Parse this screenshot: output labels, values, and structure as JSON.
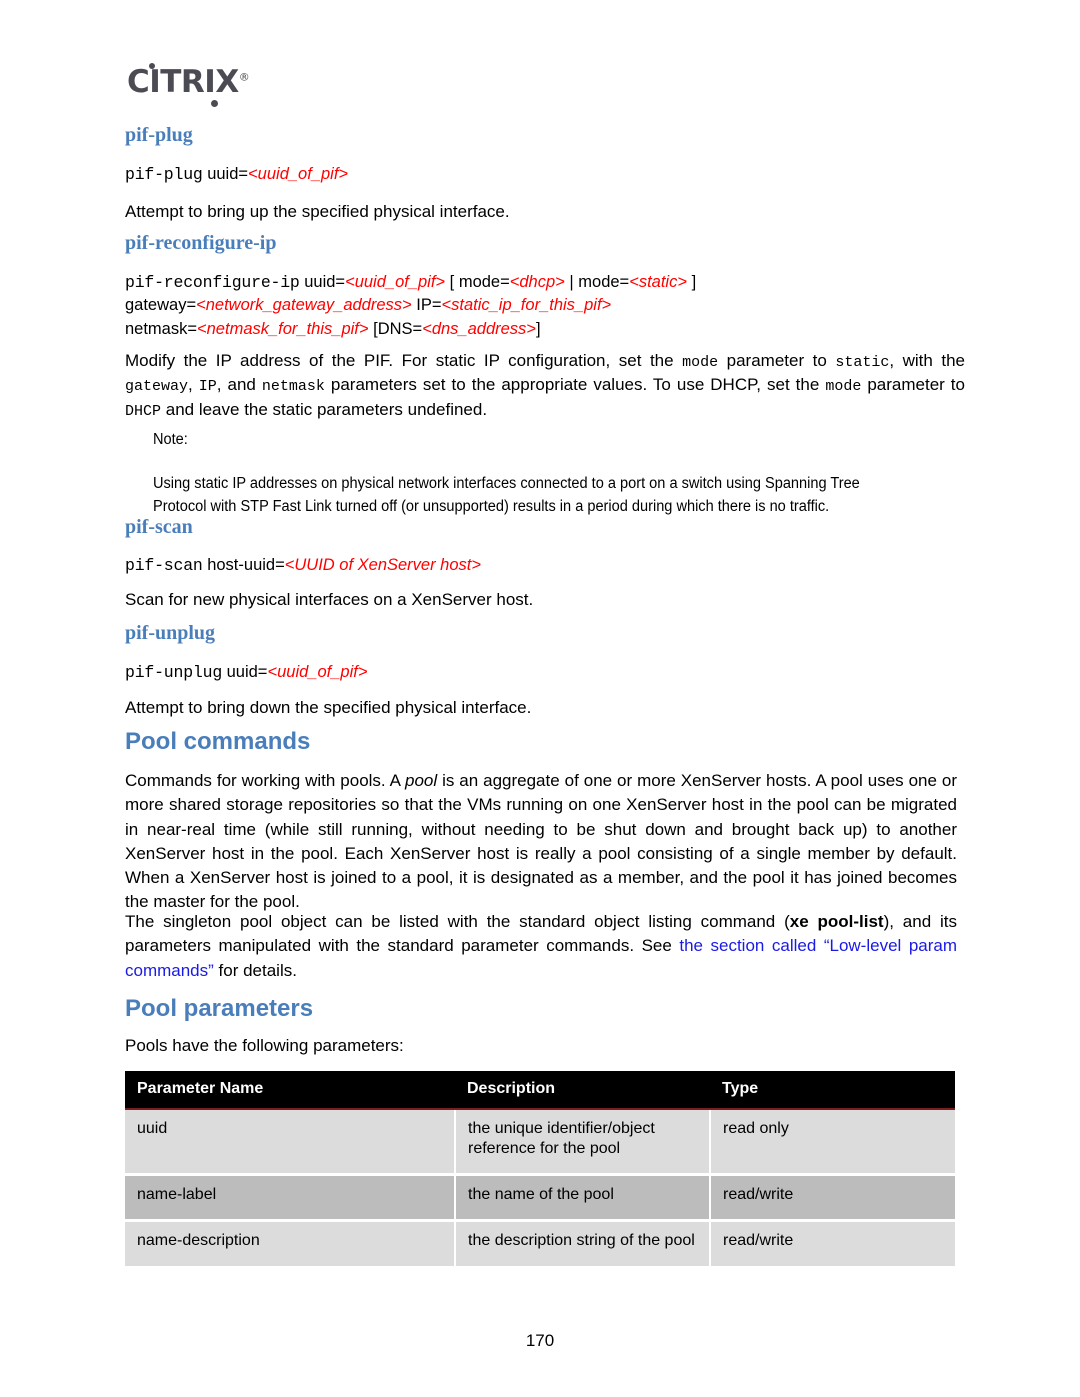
{
  "brand": {
    "logo_text": "CITRIX",
    "logo_trademark": "®",
    "logo_color": "#4b4b54"
  },
  "colors": {
    "command_heading": "#4a7ebb",
    "section_heading": "#4a7ebb",
    "replaceable": "#ff0000",
    "link": "#1a1ae6",
    "table_header_bg": "#000000",
    "table_header_text": "#ffffff",
    "table_row_light": "#dcdcdc",
    "table_row_dark": "#bcbcbc",
    "table_header_rule": "#7a1f20"
  },
  "sections": {
    "pif_plug": {
      "heading": "pif-plug",
      "synopsis": {
        "command": "pif-plug",
        "args_prefix": " uuid=",
        "replaceable": "<uuid_of_pif>"
      },
      "description": "Attempt to bring up the specified physical interface."
    },
    "pif_reconfigure_ip": {
      "heading": "pif-reconfigure-ip",
      "synopsis": {
        "command": "pif-reconfigure-ip",
        "line1_a": " uuid=",
        "line1_r1": "<uuid_of_pif>",
        "line1_b": " [ mode=",
        "line1_r2": "<dhcp>",
        "line1_c": " | mode=",
        "line1_r3": "<static>",
        "line1_d": " ]",
        "line2_a": "gateway=",
        "line2_r1": "<network_gateway_address>",
        "line2_b": " IP=",
        "line2_r2": "<static_ip_for_this_pif>",
        "line3_a": "netmask=",
        "line3_r1": "<netmask_for_this_pif>",
        "line3_b": " [DNS=",
        "line3_r2": "<dns_address>",
        "line3_c": "]"
      },
      "description_parts": [
        {
          "t": "Modify the IP address of the PIF. For static IP configuration, set the ",
          "s": "plain"
        },
        {
          "t": "mode",
          "s": "mono"
        },
        {
          "t": " parameter to ",
          "s": "plain"
        },
        {
          "t": "static",
          "s": "mono"
        },
        {
          "t": ", with the ",
          "s": "plain"
        },
        {
          "t": "gateway",
          "s": "mono"
        },
        {
          "t": ", ",
          "s": "plain"
        },
        {
          "t": "IP",
          "s": "mono"
        },
        {
          "t": ", and ",
          "s": "plain"
        },
        {
          "t": "netmask",
          "s": "mono"
        },
        {
          "t": " parameters set to the appropriate values. To use DHCP, set the ",
          "s": "plain"
        },
        {
          "t": "mode",
          "s": "mono"
        },
        {
          "t": " parameter to ",
          "s": "plain"
        },
        {
          "t": "DHCP",
          "s": "mono"
        },
        {
          "t": " and leave the static parameters undefined.",
          "s": "plain"
        }
      ],
      "note": {
        "label": "Note:",
        "body": "Using static IP addresses on physical network interfaces connected to a port on a switch using Spanning Tree Protocol with STP Fast Link turned off (or unsupported) results in a period during which there is no traffic."
      }
    },
    "pif_scan": {
      "heading": "pif-scan",
      "synopsis": {
        "command": "pif-scan",
        "args_prefix": " host-uuid=",
        "replaceable": "<UUID of XenServer host>"
      },
      "description": "Scan for new physical interfaces on a XenServer host."
    },
    "pif_unplug": {
      "heading": "pif-unplug",
      "synopsis": {
        "command": "pif-unplug",
        "args_prefix": " uuid=",
        "replaceable": "<uuid_of_pif>"
      },
      "description": "Attempt to bring down the specified physical interface."
    },
    "pool_commands": {
      "heading": "Pool commands",
      "paragraph1_parts": [
        {
          "t": "Commands for working with pools. A ",
          "s": "plain"
        },
        {
          "t": "pool",
          "s": "italic"
        },
        {
          "t": " is an aggregate of one or more XenServer hosts. A pool uses one or more shared storage repositories so that the VMs running on one XenServer host in the pool can be migrated in near-real time (while still running, without needing to be shut down and brought back up) to another XenServer host in the pool. Each XenServer host is really a pool consisting of a single member by default. When a XenServer host is joined to a pool, it is designated as a member, and the pool it has joined becomes the master for the pool.",
          "s": "plain"
        }
      ],
      "paragraph2_parts": [
        {
          "t": "The singleton pool object can be listed with the standard object listing command (",
          "s": "plain"
        },
        {
          "t": "xe pool-list",
          "s": "bold"
        },
        {
          "t": "), and its parameters manipulated with the standard parameter commands. See ",
          "s": "plain"
        },
        {
          "t": "the section called “Low-level param commands”",
          "s": "link"
        },
        {
          "t": " for details.",
          "s": "plain"
        }
      ]
    },
    "pool_parameters": {
      "heading": "Pool parameters",
      "intro": "Pools have the following parameters:",
      "table": {
        "columns": [
          "Parameter Name",
          "Description",
          "Type"
        ],
        "rows": [
          {
            "name": "uuid",
            "description": "the unique identifier/object reference for the pool",
            "type": "read only"
          },
          {
            "name": "name-label",
            "description": "the name of the pool",
            "type": "read/write"
          },
          {
            "name": "name-description",
            "description": "the description string of the pool",
            "type": "read/write"
          }
        ]
      }
    }
  },
  "footer": {
    "page_number": "170"
  }
}
